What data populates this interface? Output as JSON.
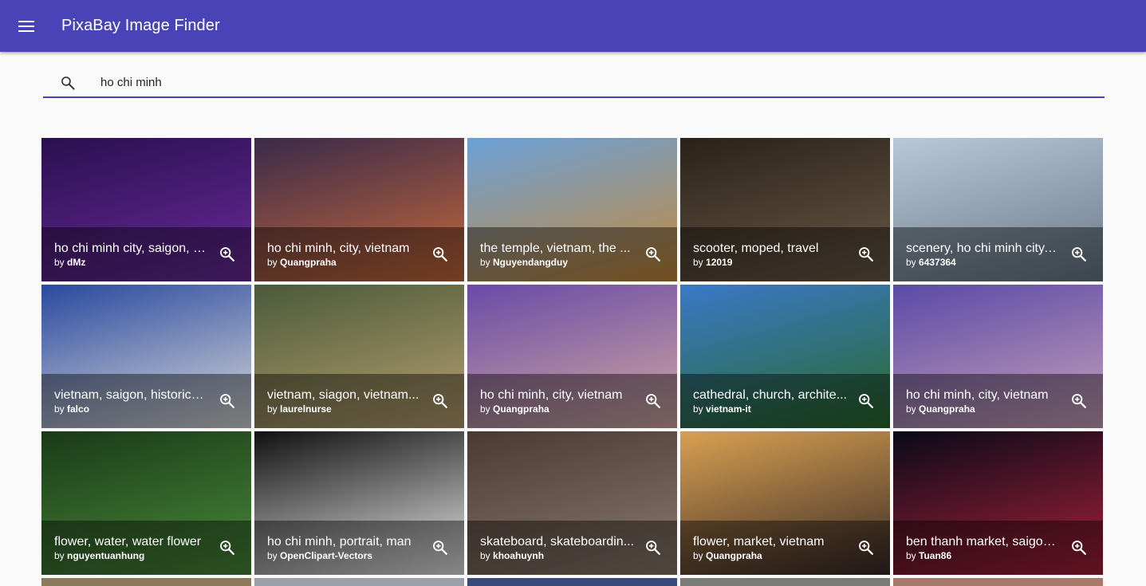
{
  "app": {
    "title": "PixaBay Image Finder",
    "menu_icon": "menu-icon"
  },
  "search": {
    "value": "ho chi minh",
    "icon": "search-icon"
  },
  "tiles": [
    {
      "title": "ho chi minh city, saigon, h...",
      "by": "by ",
      "user": "dMz",
      "colors": [
        "#2a1050",
        "#6a2a9a"
      ]
    },
    {
      "title": "ho chi minh, city, vietnam",
      "by": "by ",
      "user": "Quangpraha",
      "colors": [
        "#3a2a4a",
        "#c86a3a"
      ]
    },
    {
      "title": "the temple, vietnam, the ...",
      "by": "by ",
      "user": "Nguyendangduy",
      "colors": [
        "#6aa0d8",
        "#c88a3a"
      ]
    },
    {
      "title": "scooter, moped, travel",
      "by": "by ",
      "user": "12019",
      "colors": [
        "#2a2218",
        "#6a5a48"
      ]
    },
    {
      "title": "scenery, ho chi minh city, ...",
      "by": "by ",
      "user": "6437364",
      "colors": [
        "#b8c8d8",
        "#6a7888"
      ]
    },
    {
      "title": "vietnam, saigon, historically",
      "by": "by ",
      "user": "falco",
      "colors": [
        "#2a4aa0",
        "#d8d8d8"
      ]
    },
    {
      "title": "vietnam, siagon, vietnam...",
      "by": "by ",
      "user": "laurelnurse",
      "colors": [
        "#4a5a3a",
        "#b8a070"
      ]
    },
    {
      "title": "ho chi minh, city, vietnam",
      "by": "by ",
      "user": "Quangpraha",
      "colors": [
        "#6a4aa8",
        "#d0a8a0"
      ]
    },
    {
      "title": "cathedral, church, archite...",
      "by": "by ",
      "user": "vietnam-it",
      "colors": [
        "#3a78c8",
        "#2a6a2a"
      ]
    },
    {
      "title": "ho chi minh, city, vietnam",
      "by": "by ",
      "user": "Quangpraha",
      "colors": [
        "#5a4aa8",
        "#c8a0b8"
      ]
    },
    {
      "title": "flower, water, water flower",
      "by": "by ",
      "user": "nguyentuanhung",
      "colors": [
        "#1a3a18",
        "#4a8a3a"
      ]
    },
    {
      "title": "ho chi minh, portrait, man",
      "by": "by ",
      "user": "OpenClipart-Vectors",
      "colors": [
        "#111111",
        "#e8e8e8"
      ]
    },
    {
      "title": "skateboard, skateboardin...",
      "by": "by ",
      "user": "khoahuynh",
      "colors": [
        "#4a3a30",
        "#8a7a70"
      ]
    },
    {
      "title": "flower, market, vietnam",
      "by": "by ",
      "user": "Quangpraha",
      "colors": [
        "#d8a050",
        "#3a2a28"
      ]
    },
    {
      "title": "ben thanh market, saigon...",
      "by": "by ",
      "user": "Tuan86",
      "colors": [
        "#0a0a18",
        "#a8203a"
      ]
    }
  ],
  "zoom_icon": "zoom-in-icon",
  "accent_color": "#4a43b8"
}
